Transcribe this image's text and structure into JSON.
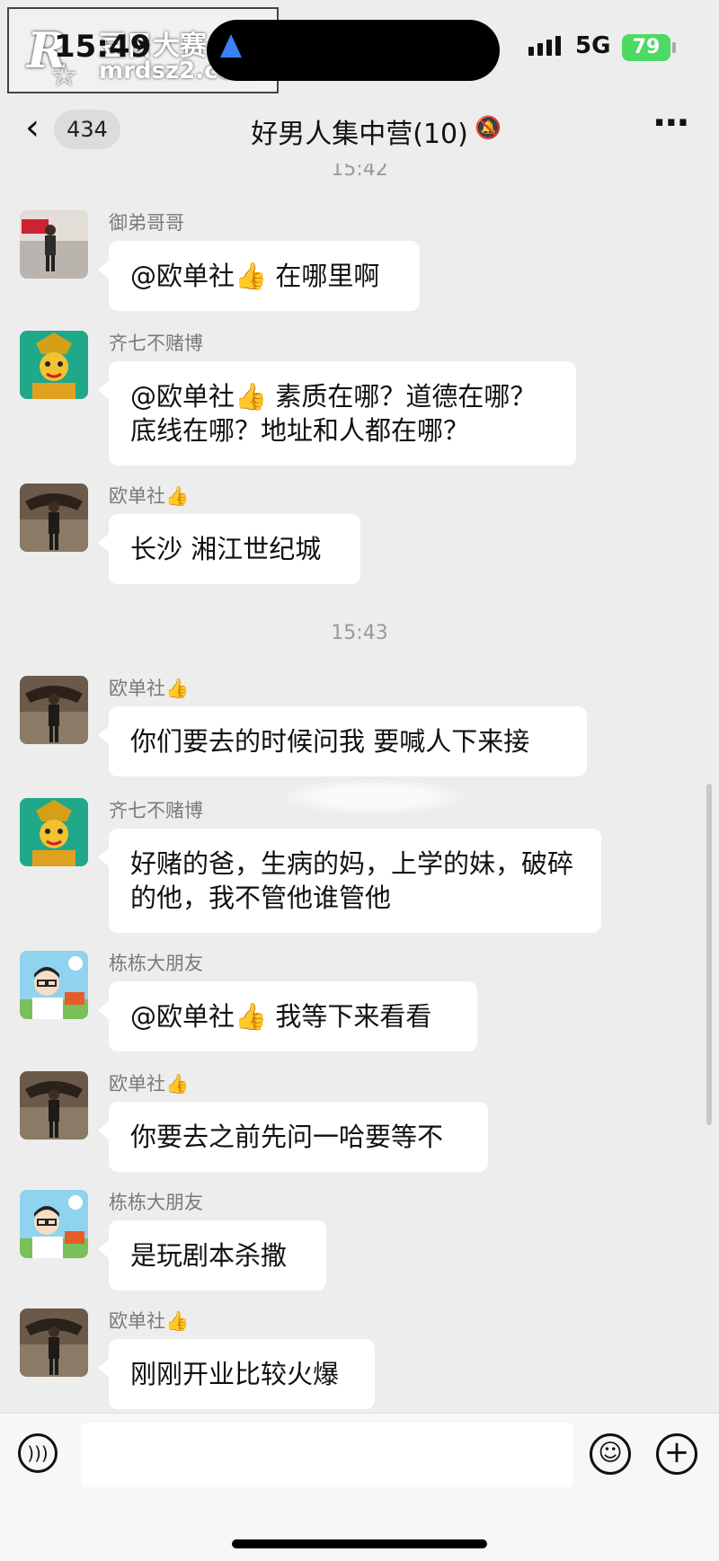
{
  "status_bar": {
    "time": "15:49",
    "network": "5G",
    "battery": "79",
    "watermark": {
      "logo": "R",
      "name": "豆日大赛",
      "url": "mrdsz2.com"
    }
  },
  "header": {
    "back_count": "434",
    "title": "好男人集中营(10)",
    "icons": {
      "back": "chevron-left-icon",
      "mute": "bell-muted-icon",
      "more": "more-icon"
    }
  },
  "chat": {
    "top_timestamp": "15:42",
    "mid_timestamp": "15:43",
    "messages": [
      {
        "sender": "御弟哥哥",
        "text": "@欧单社👍 在哪里啊"
      },
      {
        "sender": "齐七不赌博",
        "text": "@欧单社👍 素质在哪？道德在哪？底线在哪？地址和人都在哪？"
      },
      {
        "sender": "欧单社👍",
        "text": "长沙 湘江世纪城"
      },
      {
        "sender": "欧单社👍",
        "text": "你们要去的时候问我 要喊人下来接"
      },
      {
        "sender": "齐七不赌博",
        "text": "好赌的爸，生病的妈，上学的妹，破碎的他，我不管他谁管他"
      },
      {
        "sender": "栋栋大朋友",
        "text": "@欧单社👍 我等下来看看"
      },
      {
        "sender": "欧单社👍",
        "text": "你要去之前先问一哈要等不"
      },
      {
        "sender": "栋栋大朋友",
        "text": "是玩剧本杀撒"
      },
      {
        "sender": "欧单社👍",
        "text": "刚刚开业比较火爆"
      }
    ]
  },
  "input_bar": {
    "value": "",
    "icons": {
      "voice": "voice-icon",
      "emoji": "emoji-icon",
      "plus": "plus-icon"
    }
  },
  "colors": {
    "background": "#ededed",
    "bubble": "#ffffff",
    "battery": "#4cd964",
    "nav_arrow": "#3b82f6"
  }
}
